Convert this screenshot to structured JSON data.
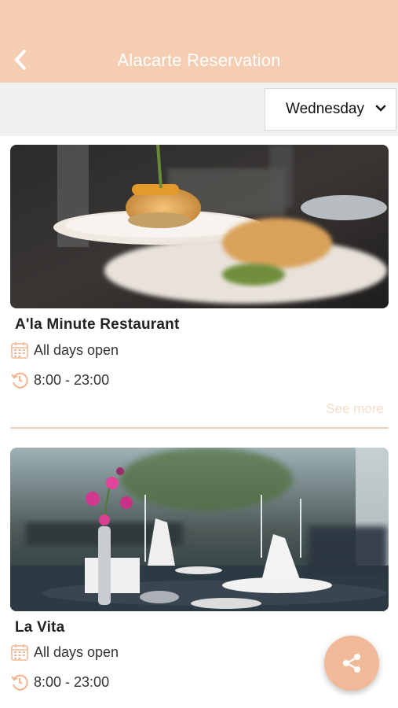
{
  "header": {
    "title": "Alacarte Reservation",
    "back_icon": "chevron-left-icon"
  },
  "filter": {
    "selected_day": "Wednesday",
    "icon": "chevron-down-icon"
  },
  "restaurants": [
    {
      "name": "A'la Minute Restaurant",
      "days": "All days open",
      "hours": "8:00 - 23:00",
      "see_more": "See more"
    },
    {
      "name": "La Vita",
      "days": "All days open",
      "hours": "8:00 - 23:00"
    }
  ],
  "share": {
    "icon": "share-icon"
  },
  "colors": {
    "accent": "#f5cdb3",
    "fab": "#f2b999",
    "icon": "#f0b898"
  }
}
